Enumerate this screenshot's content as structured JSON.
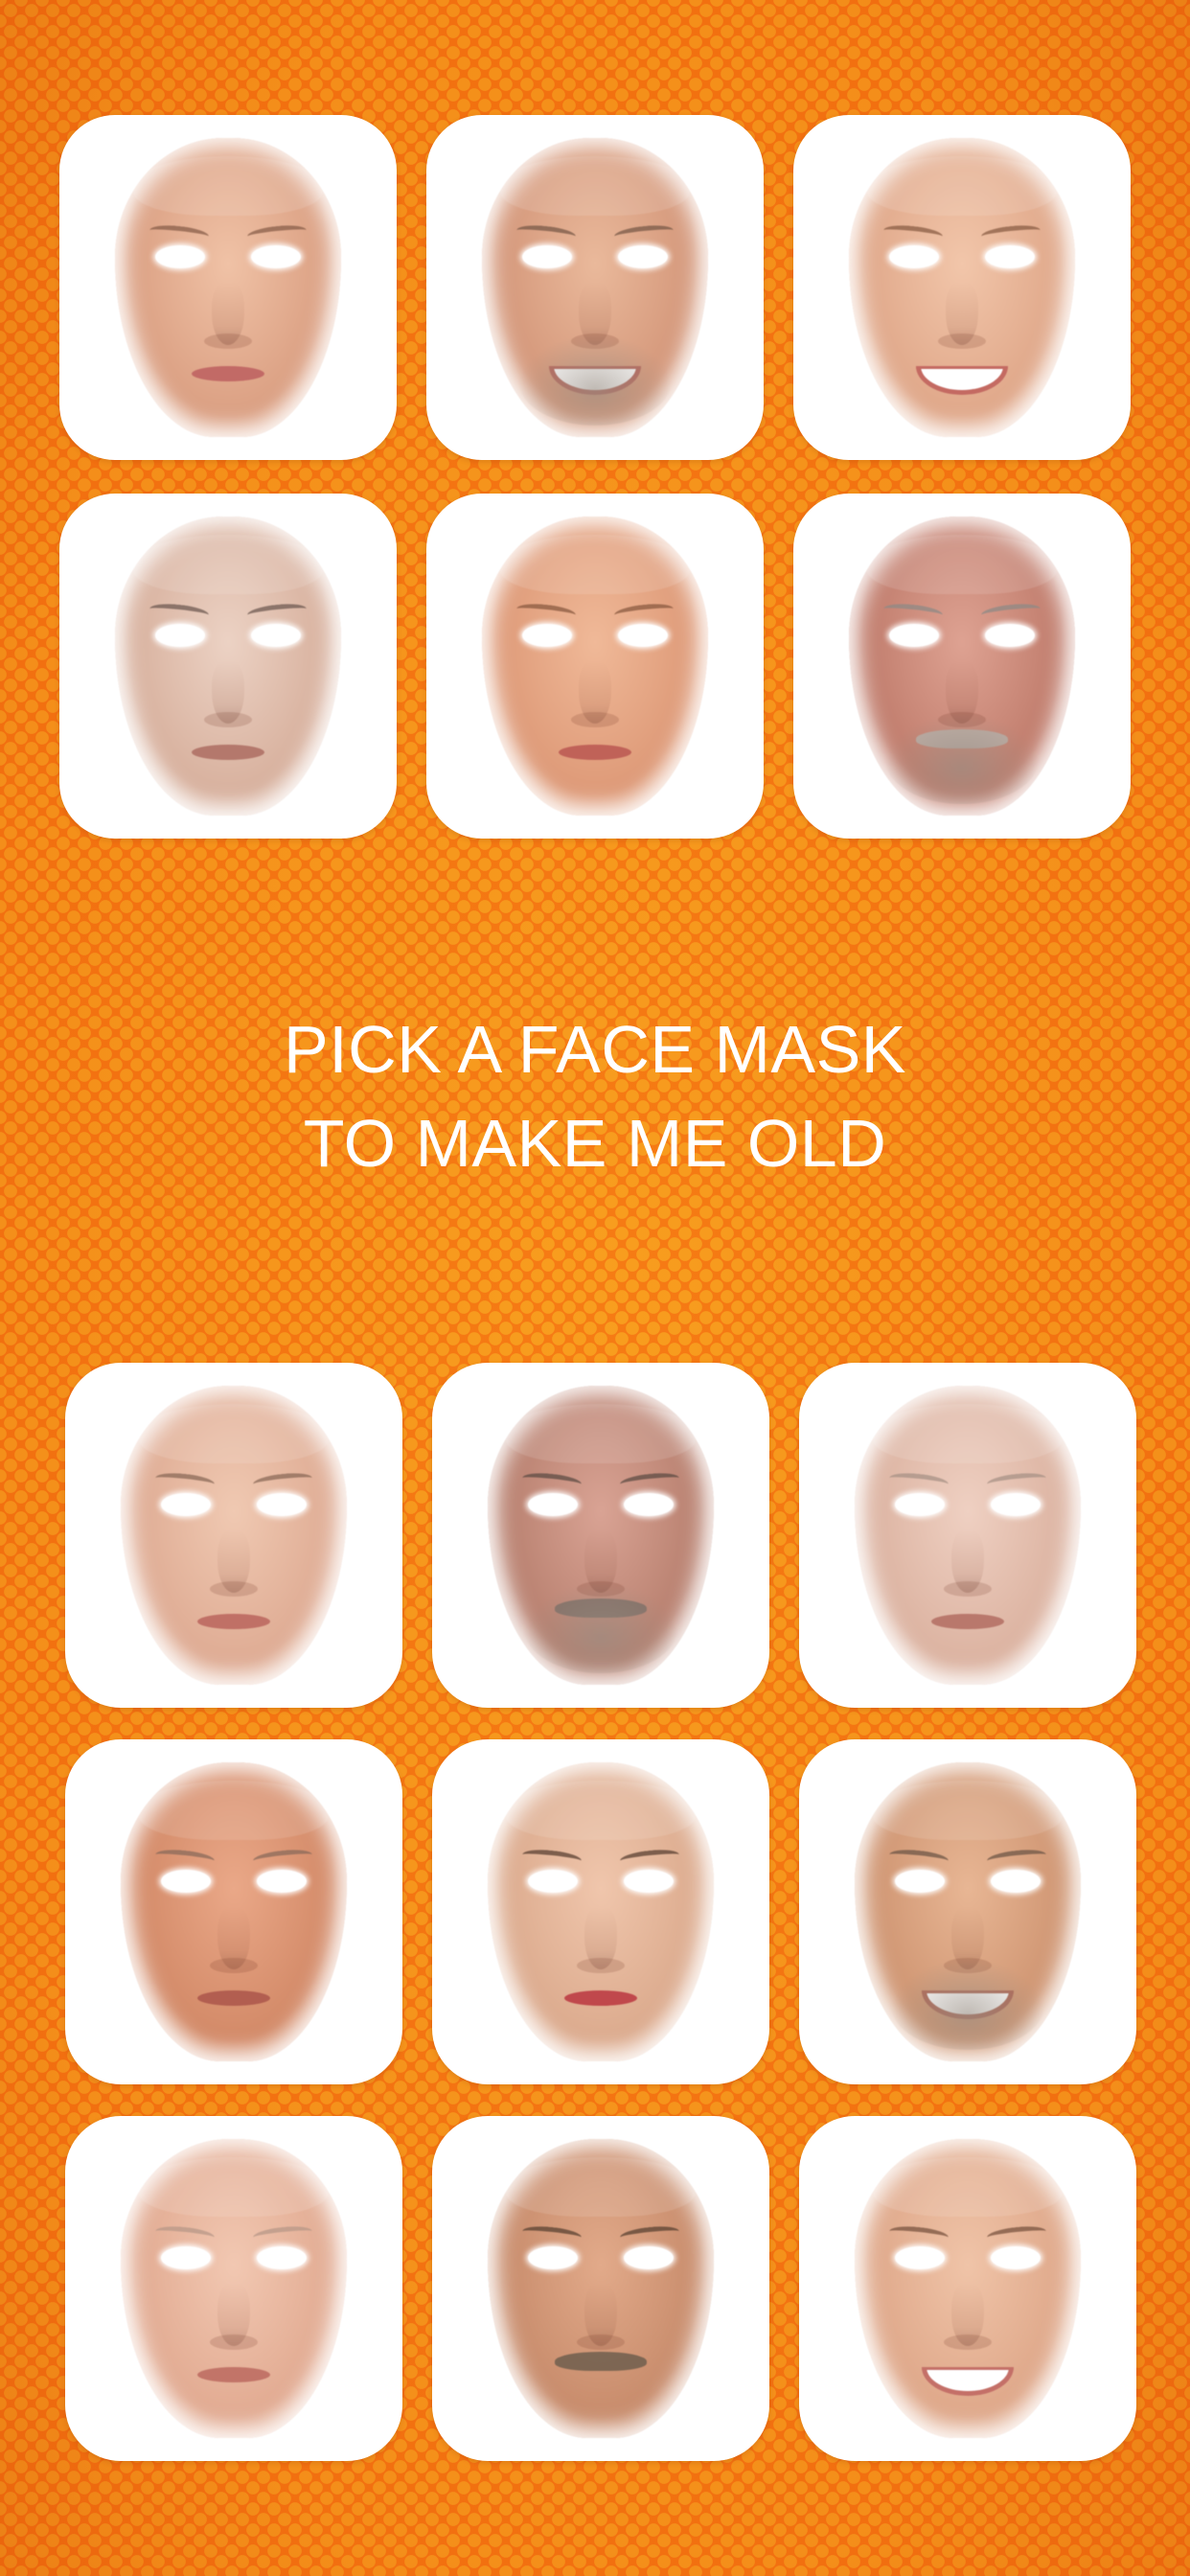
{
  "title": {
    "line1": "PICK A FACE MASK",
    "line2": "TO MAKE ME OLD"
  },
  "colors": {
    "background": "#f57a14",
    "dots": "#f7a020",
    "tile": "#ffffff",
    "title_text": "#ffffff"
  },
  "masks": [
    {
      "icon": "face-mask-woman-icon"
    },
    {
      "icon": "face-mask-man-smiling-icon"
    },
    {
      "icon": "face-mask-woman-smiling-icon"
    },
    {
      "icon": "face-mask-man-icon"
    },
    {
      "icon": "face-mask-woman-smiling-icon"
    },
    {
      "icon": "face-mask-man-mustache-icon"
    },
    {
      "icon": "face-mask-woman-smiling-icon"
    },
    {
      "icon": "face-mask-man-beard-icon"
    },
    {
      "icon": "face-mask-woman-icon"
    },
    {
      "icon": "face-mask-man-smiling-icon"
    },
    {
      "icon": "face-mask-woman-icon"
    },
    {
      "icon": "face-mask-man-beard-smiling-icon"
    },
    {
      "icon": "face-mask-woman-icon"
    },
    {
      "icon": "face-mask-man-mustache-icon"
    },
    {
      "icon": "face-mask-woman-smiling-icon"
    }
  ]
}
